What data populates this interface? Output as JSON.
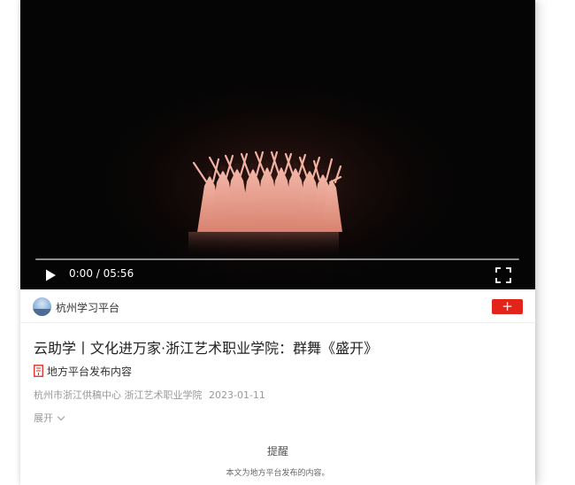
{
  "video": {
    "current_time": "0:00",
    "duration": "05:56",
    "time_display": "0:00 / 05:56",
    "progress": 0.0
  },
  "publisher": {
    "name": "杭州学习平台",
    "follow_label": "+"
  },
  "article": {
    "title": "云助学丨文化进万家·浙江艺术职业学院：群舞《盛开》",
    "source_label": "地方平台发布内容",
    "meta_source": "杭州市浙江供稿中心 浙江艺术职业学院",
    "date": "2023-01-11",
    "expand_label": "展开"
  },
  "notice": {
    "title": "提醒",
    "text": "本文为地方平台发布的内容。"
  },
  "colors": {
    "accent_red": "#e3241b",
    "video_background": "#050505",
    "dancer_costume": "#e89a8a"
  },
  "icons": {
    "play": "play-icon",
    "fullscreen": "fullscreen-icon",
    "source": "local-platform-badge-icon",
    "expand": "chevron-down-icon"
  }
}
